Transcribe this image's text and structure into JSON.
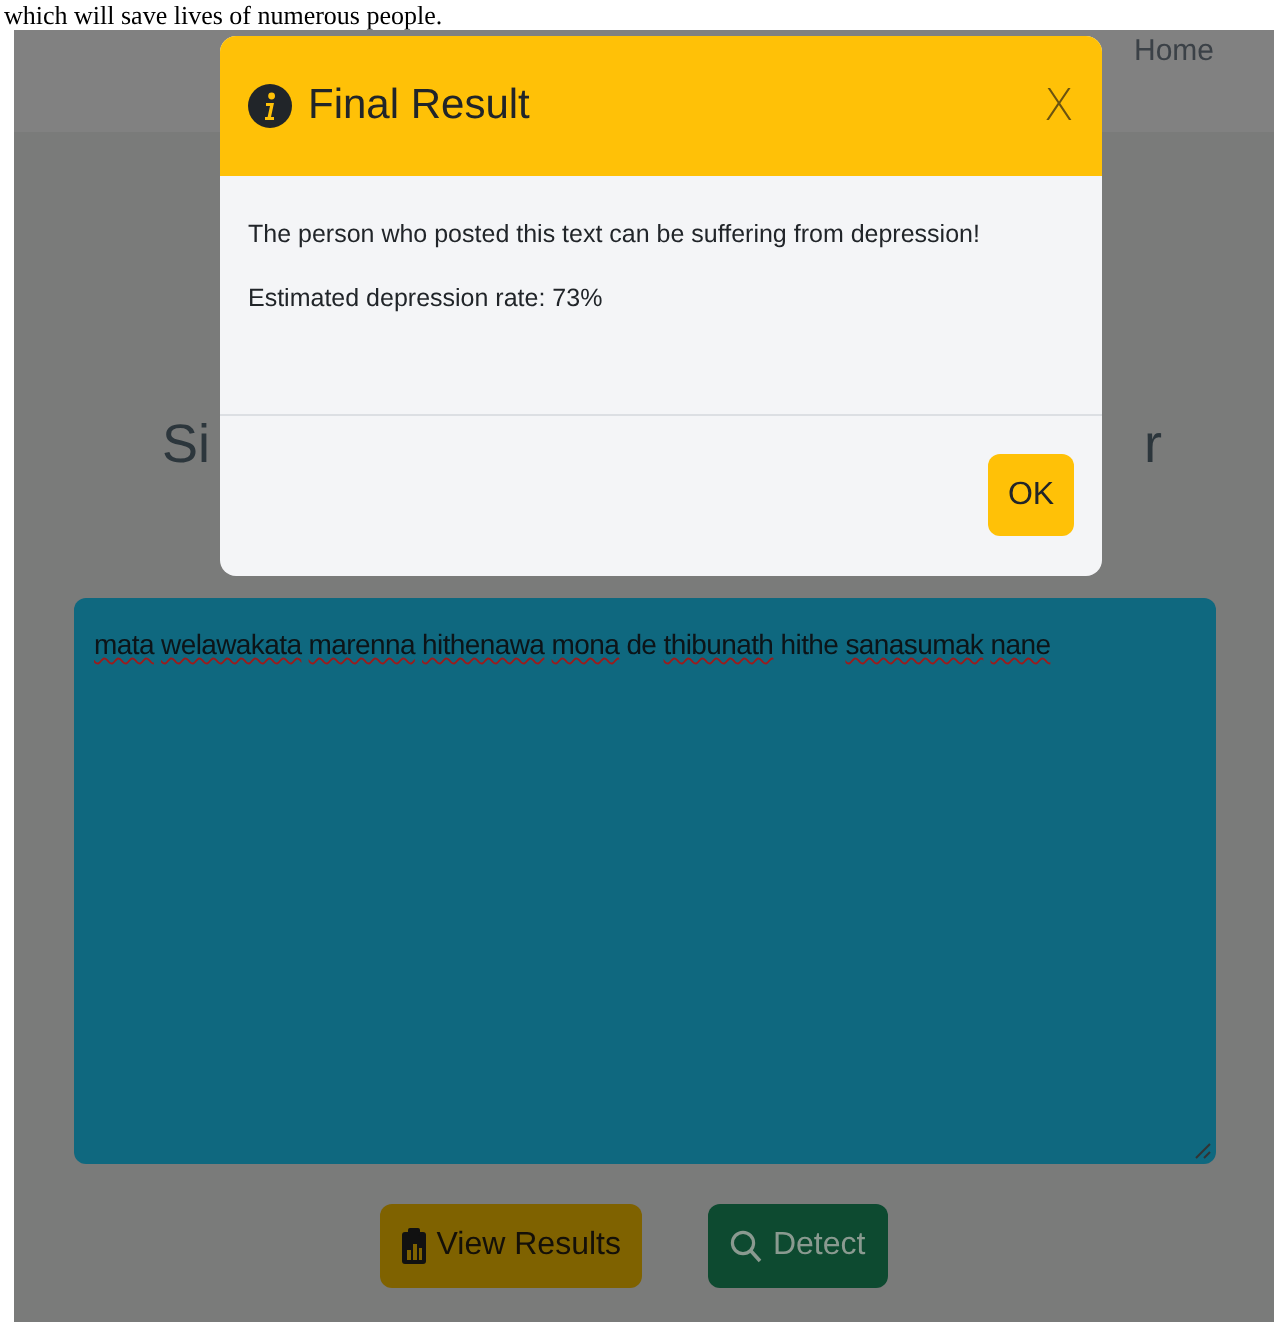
{
  "caption": "which will save lives of numerous people.",
  "navbar": {
    "items": [
      "Home"
    ]
  },
  "heading": {
    "visible_start": "Si",
    "visible_end": "r"
  },
  "text_input": {
    "words": [
      {
        "text": "mata",
        "misspelled": true
      },
      {
        "text": "welawakata",
        "misspelled": true
      },
      {
        "text": "marenna",
        "misspelled": true
      },
      {
        "text": "hithenawa",
        "misspelled": true
      },
      {
        "text": "mona",
        "misspelled": true
      },
      {
        "text": "de",
        "misspelled": false
      },
      {
        "text": "thibunath",
        "misspelled": true
      },
      {
        "text": "hithe",
        "misspelled": false
      },
      {
        "text": "sanasumak",
        "misspelled": true
      },
      {
        "text": "nane",
        "misspelled": true
      }
    ]
  },
  "buttons": [
    {
      "kind": "results",
      "label": "View Results"
    },
    {
      "kind": "detect",
      "label": "Detect"
    }
  ],
  "modal": {
    "title": "Final Result",
    "close": "X",
    "message": "The person who posted this text can be suffering from depression!",
    "rate": "Estimated depression rate: 73%",
    "ok": "OK"
  }
}
